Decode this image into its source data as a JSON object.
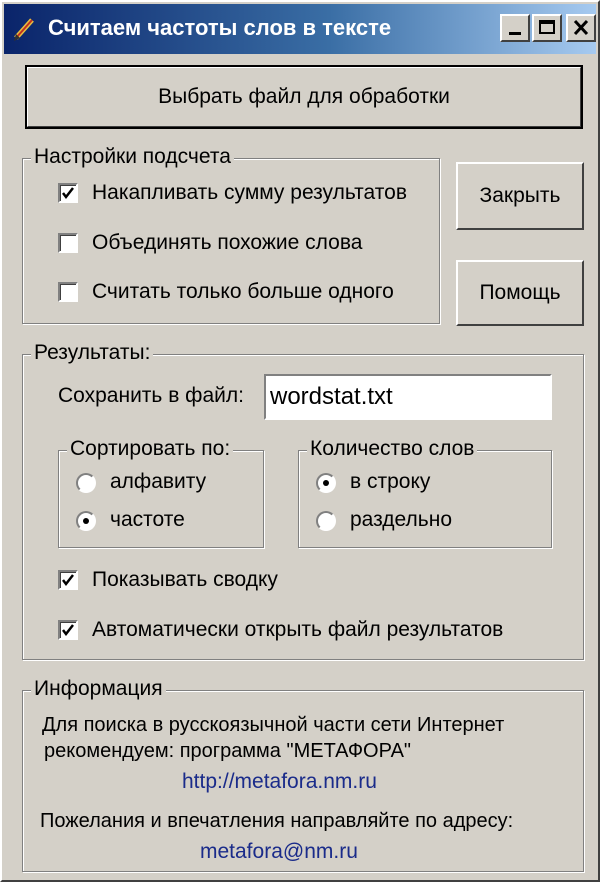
{
  "window": {
    "title": "Считаем частоты слов в тексте",
    "icon": "pen-icon",
    "controls": [
      "minimize-icon",
      "maximize-icon",
      "close-icon"
    ]
  },
  "buttons": {
    "select_file": "Выбрать файл для обработки",
    "close": "Закрыть",
    "help": "Помощь"
  },
  "settings": {
    "legend": "Настройки подсчета",
    "options": [
      {
        "label": "Накапливать сумму результатов",
        "checked": true
      },
      {
        "label": "Объединять похожие слова",
        "checked": false
      },
      {
        "label": "Считать только больше одного",
        "checked": false
      }
    ]
  },
  "results": {
    "legend": "Результаты:",
    "save_label": "Сохранить в файл:",
    "save_value": "wordstat.txt",
    "sort": {
      "legend": "Сортировать по:",
      "options": [
        {
          "label": "алфавиту",
          "selected": false
        },
        {
          "label": "частоте",
          "selected": true
        }
      ]
    },
    "count": {
      "legend": "Количество слов",
      "options": [
        {
          "label": "в строку",
          "selected": true
        },
        {
          "label": "раздельно",
          "selected": false
        }
      ]
    },
    "show_summary": {
      "label": "Показывать сводку",
      "checked": true
    },
    "auto_open": {
      "label": "Автоматически открыть файл результатов",
      "checked": true
    }
  },
  "info": {
    "legend": "Информация",
    "line1": "Для поиска в русскоязычной части сети Интернет",
    "line2": "рекомендуем:  программа \"МЕТАФОРА\"",
    "url": "http://metafora.nm.ru",
    "line3": "Пожелания и впечатления направляйте по адресу:",
    "email": "metafora@nm.ru"
  },
  "colors": {
    "face": "#d4d0c8",
    "title_start": "#0a246a",
    "title_end": "#a6caf0",
    "link": "#1a2b8a"
  }
}
